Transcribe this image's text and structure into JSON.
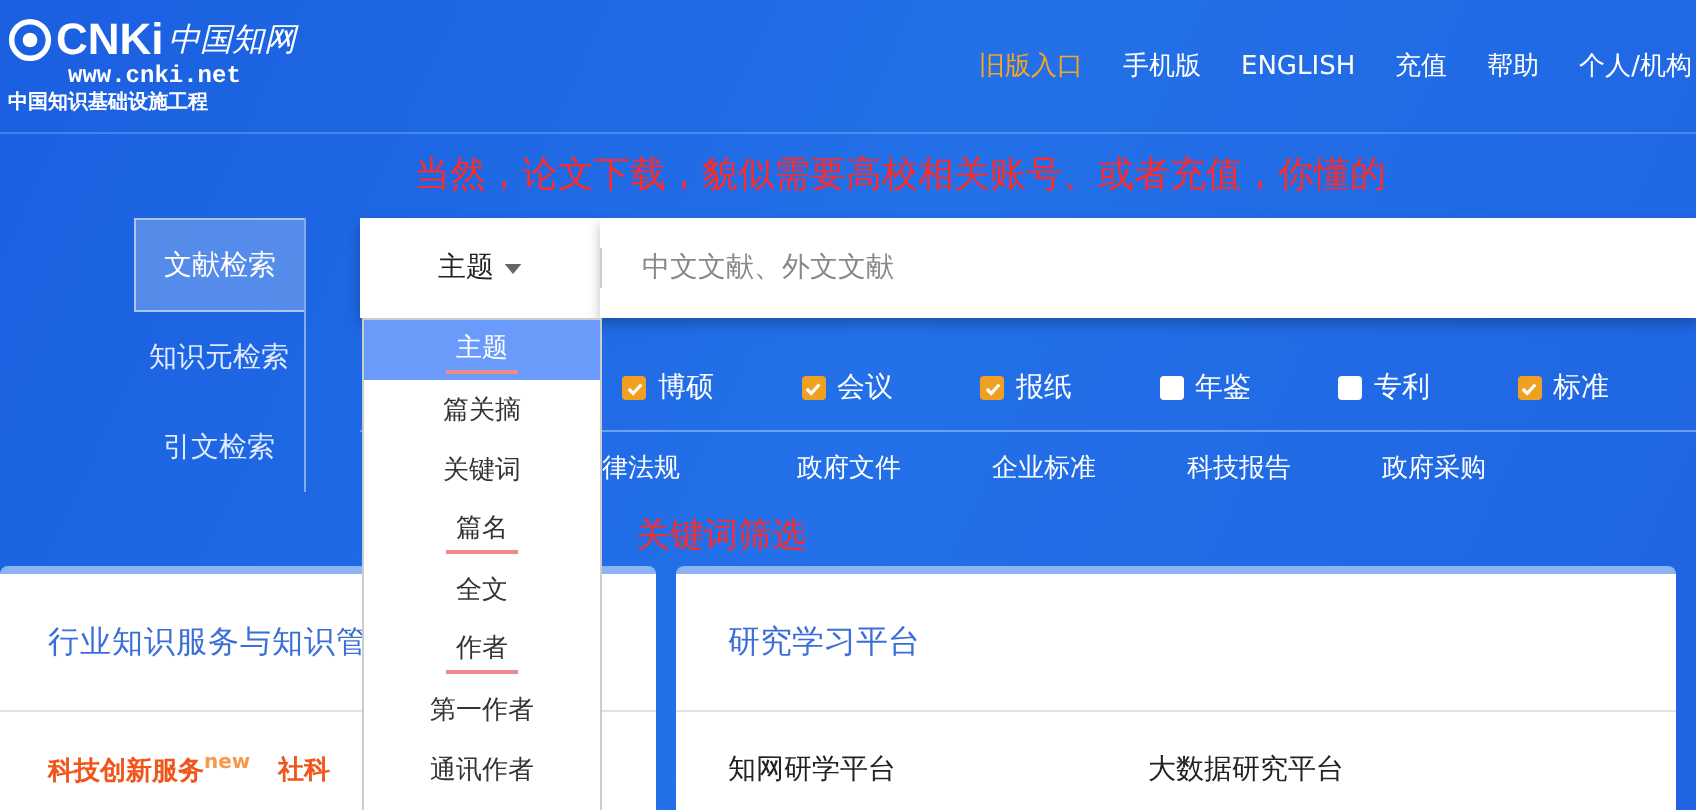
{
  "logo": {
    "brand": "CNKi",
    "cn_name": "中国知网",
    "url": "www.cnki.net",
    "slogan": "中国知识基础设施工程"
  },
  "nav": [
    {
      "label": "旧版入口",
      "accent": true
    },
    {
      "label": "手机版",
      "accent": false
    },
    {
      "label": "ENGLISH",
      "accent": false
    },
    {
      "label": "充值",
      "accent": false
    },
    {
      "label": "帮助",
      "accent": false
    },
    {
      "label": "个人/机构",
      "accent": false
    }
  ],
  "annotations": [
    "当然，论文下载，貌似需要高校相关账号、或者充值，你懂的",
    "关键词筛选"
  ],
  "search_tabs": [
    {
      "label": "文献检索",
      "selected": true
    },
    {
      "label": "知识元检索",
      "selected": false
    },
    {
      "label": "引文检索",
      "selected": false
    }
  ],
  "search": {
    "field_type": "主题",
    "placeholder": "中文文献、外文文献"
  },
  "field_menu": [
    {
      "label": "主题",
      "selected": true,
      "underlined": true
    },
    {
      "label": "篇关摘",
      "selected": false,
      "underlined": false
    },
    {
      "label": "关键词",
      "selected": false,
      "underlined": false
    },
    {
      "label": "篇名",
      "selected": false,
      "underlined": true
    },
    {
      "label": "全文",
      "selected": false,
      "underlined": false
    },
    {
      "label": "作者",
      "selected": false,
      "underlined": true
    },
    {
      "label": "第一作者",
      "selected": false,
      "underlined": false
    },
    {
      "label": "通讯作者",
      "selected": false,
      "underlined": false
    }
  ],
  "sources": [
    {
      "label": "博硕",
      "checked": true
    },
    {
      "label": "会议",
      "checked": true
    },
    {
      "label": "报纸",
      "checked": true
    },
    {
      "label": "年鉴",
      "checked": false
    },
    {
      "label": "专利",
      "checked": false
    },
    {
      "label": "标准",
      "checked": true
    }
  ],
  "more_sources": [
    "律法规",
    "政府文件",
    "企业标准",
    "科技报告",
    "政府采购"
  ],
  "cards": [
    {
      "title": "行业知识服务与知识管",
      "links": [
        {
          "label": "科技创新服务",
          "badge": "new"
        },
        {
          "label": "社科"
        }
      ]
    },
    {
      "title": "研究学习平台",
      "links": [
        {
          "label": "知网研学平台"
        },
        {
          "label": "大数据研究平台"
        }
      ]
    }
  ]
}
